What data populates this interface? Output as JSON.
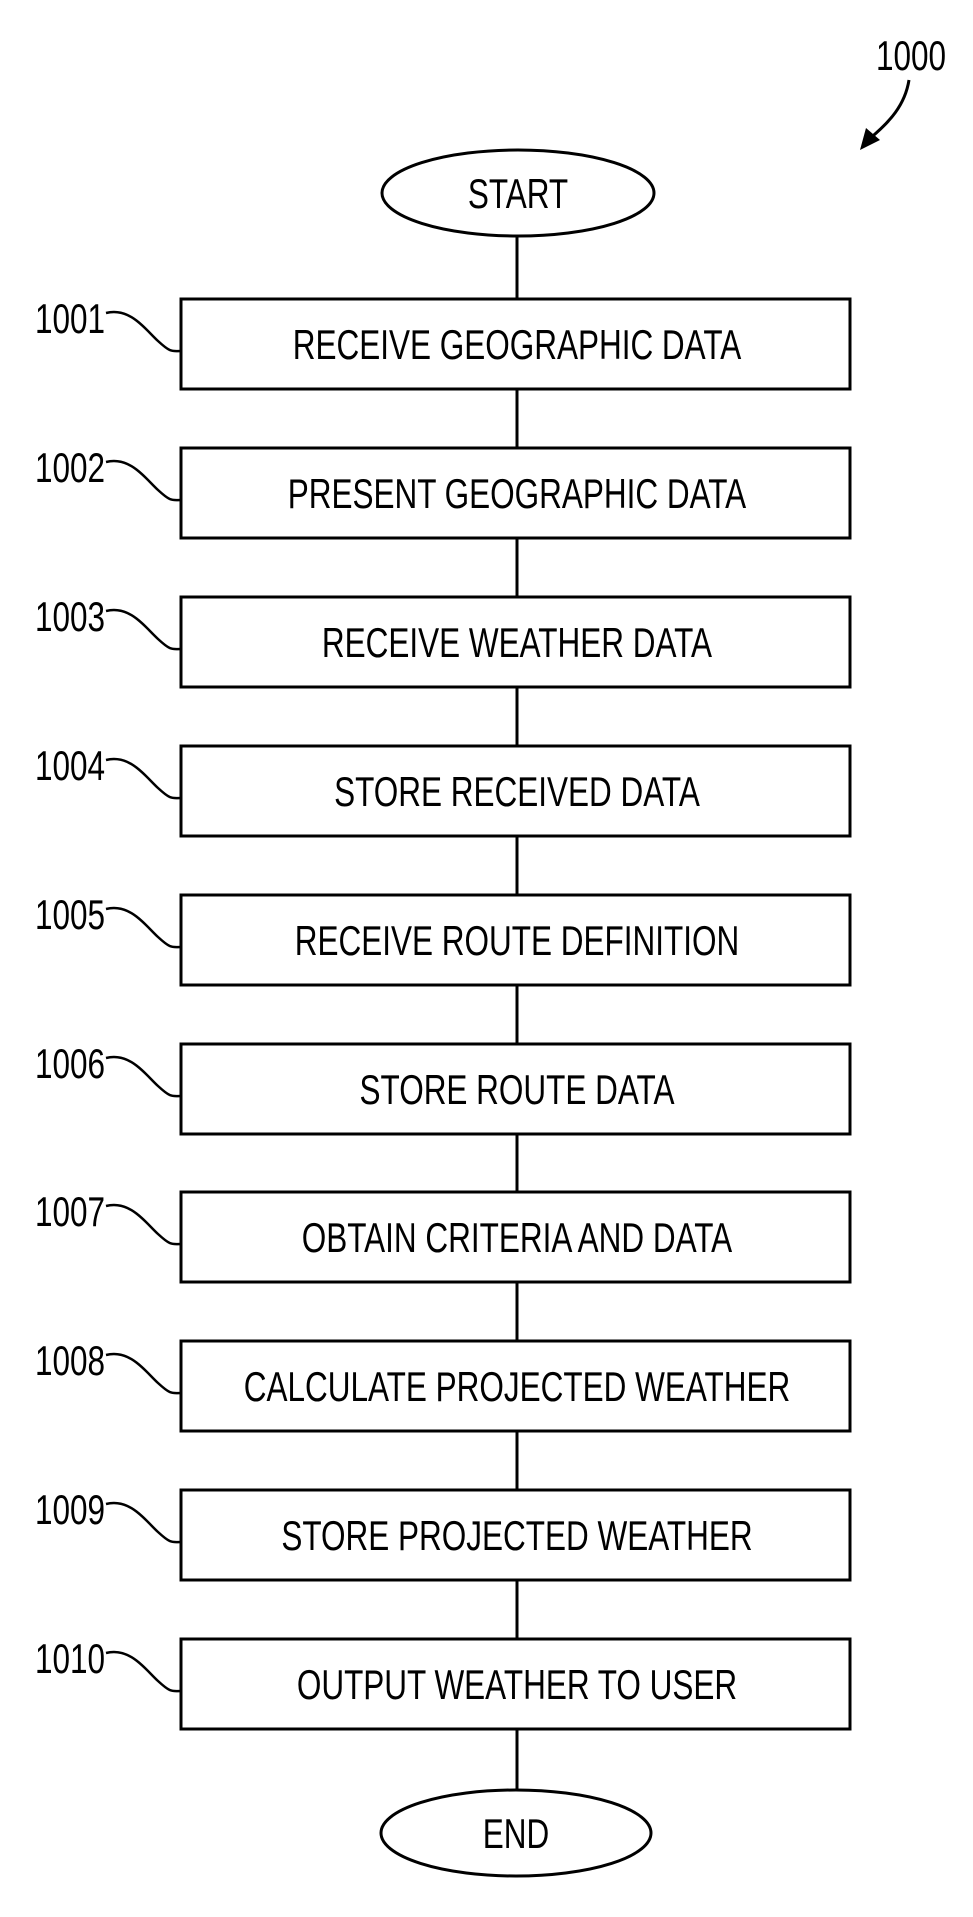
{
  "figure": {
    "reference": "1000",
    "start_label": "START",
    "end_label": "END",
    "steps": [
      {
        "id": "1001",
        "text": "RECEIVE GEOGRAPHIC DATA"
      },
      {
        "id": "1002",
        "text": "PRESENT GEOGRAPHIC DATA"
      },
      {
        "id": "1003",
        "text": "RECEIVE WEATHER DATA"
      },
      {
        "id": "1004",
        "text": "STORE RECEIVED DATA"
      },
      {
        "id": "1005",
        "text": "RECEIVE ROUTE DEFINITION"
      },
      {
        "id": "1006",
        "text": "STORE ROUTE DATA"
      },
      {
        "id": "1007",
        "text": "OBTAIN CRITERIA AND DATA"
      },
      {
        "id": "1008",
        "text": "CALCULATE PROJECTED WEATHER"
      },
      {
        "id": "1009",
        "text": "STORE PROJECTED WEATHER"
      },
      {
        "id": "1010",
        "text": "OUTPUT WEATHER TO USER"
      }
    ]
  }
}
